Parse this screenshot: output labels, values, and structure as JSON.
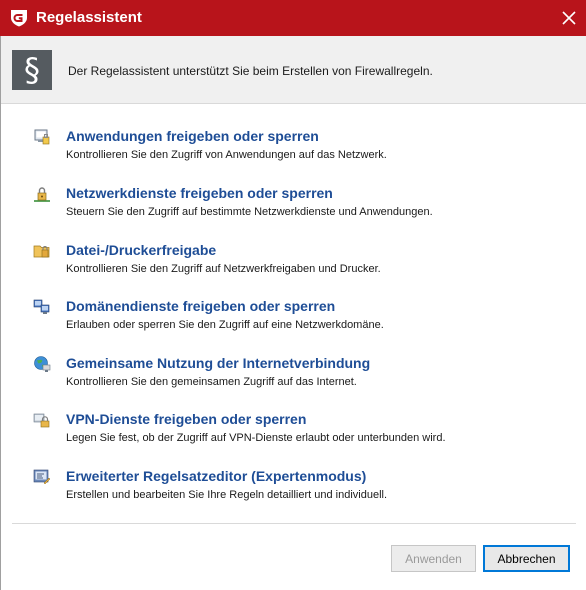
{
  "window": {
    "title": "Regelassistent"
  },
  "banner": {
    "icon": "paragraph-icon",
    "icon_glyph": "§",
    "text": "Der Regelassistent unterstützt Sie beim Erstellen von Firewallregeln."
  },
  "items": [
    {
      "icon": "application-monitor-icon",
      "title": "Anwendungen freigeben oder sperren",
      "description": "Kontrollieren Sie den Zugriff von Anwendungen auf das Netzwerk."
    },
    {
      "icon": "network-lock-icon",
      "title": "Netzwerkdienste freigeben oder sperren",
      "description": "Steuern Sie den Zugriff auf bestimmte Netzwerkdienste und Anwendungen."
    },
    {
      "icon": "folder-share-icon",
      "title": "Datei-/Druckerfreigabe",
      "description": "Kontrollieren Sie den Zugriff auf Netzwerkfreigaben und Drucker."
    },
    {
      "icon": "domain-computers-icon",
      "title": "Domänendienste freigeben oder sperren",
      "description": "Erlauben oder sperren Sie den Zugriff auf eine Netzwerkdomäne."
    },
    {
      "icon": "globe-computer-icon",
      "title": "Gemeinsame Nutzung der Internetverbindung",
      "description": "Kontrollieren Sie den gemeinsamen Zugriff auf das Internet."
    },
    {
      "icon": "vpn-lock-icon",
      "title": "VPN-Dienste freigeben oder sperren",
      "description": "Legen Sie fest, ob der Zugriff auf VPN-Dienste erlaubt oder unterbunden wird."
    },
    {
      "icon": "rule-editor-icon",
      "title": "Erweiterter Regelsatzeditor (Expertenmodus)",
      "description": "Erstellen und bearbeiten Sie Ihre Regeln detailliert und individuell."
    }
  ],
  "buttons": {
    "apply_label": "Anwenden",
    "apply_enabled": false,
    "cancel_label": "Abbrechen"
  },
  "colors": {
    "titlebar": "#b8141b",
    "link": "#1e4d96",
    "banner_bg": "#f0f0f0",
    "banner_icon_bg": "#555b60",
    "focus_border": "#0078d7"
  }
}
